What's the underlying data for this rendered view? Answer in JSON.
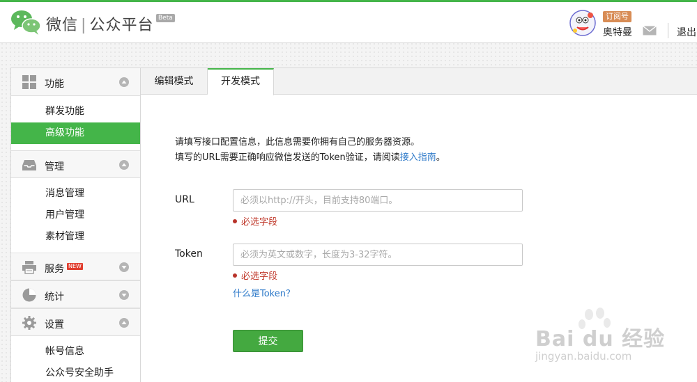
{
  "header": {
    "brand_name": "微信",
    "brand_separator": "|",
    "brand_product": "公众平台",
    "beta_badge": "Beta",
    "account_type": "订阅号",
    "account_name": "奥特曼",
    "logout_label": "退出"
  },
  "sidebar": {
    "sections": [
      {
        "label": "功能",
        "icon": "grid-icon",
        "items": [
          "群发功能",
          "高级功能"
        ],
        "active_item": "高级功能"
      },
      {
        "label": "管理",
        "icon": "inbox-icon",
        "items": [
          "消息管理",
          "用户管理",
          "素材管理"
        ]
      },
      {
        "label": "服务",
        "icon": "printer-icon",
        "badge": "NEW",
        "items": []
      },
      {
        "label": "统计",
        "icon": "pie-chart-icon",
        "items": []
      },
      {
        "label": "设置",
        "icon": "gear-icon",
        "items": [
          "帐号信息",
          "公众号安全助手"
        ]
      }
    ]
  },
  "tabs": [
    {
      "label": "编辑模式",
      "active": false
    },
    {
      "label": "开发模式",
      "active": true
    }
  ],
  "form": {
    "intro_line1": "请填写接口配置信息，此信息需要你拥有自己的服务器资源。",
    "intro_line2_prefix": "填写的URL需要正确响应微信发送的Token验证，请阅读",
    "intro_line2_link": "接入指南",
    "intro_line2_suffix": "。",
    "url_label": "URL",
    "url_placeholder": "必须以http://开头，目前支持80端口。",
    "url_value": "",
    "url_error": "必选字段",
    "token_label": "Token",
    "token_placeholder": "必须为英文或数字，长度为3-32字符。",
    "token_value": "",
    "token_error": "必选字段",
    "token_help_link": "什么是Token？",
    "submit_label": "提交"
  },
  "watermark": {
    "brand": "Bai du 经验",
    "url": "jingyan.baidu.com"
  },
  "colors": {
    "accent_green": "#44b549",
    "link_blue": "#2e7ac9",
    "error_red": "#c0392b",
    "account_badge": "#d88c55"
  }
}
